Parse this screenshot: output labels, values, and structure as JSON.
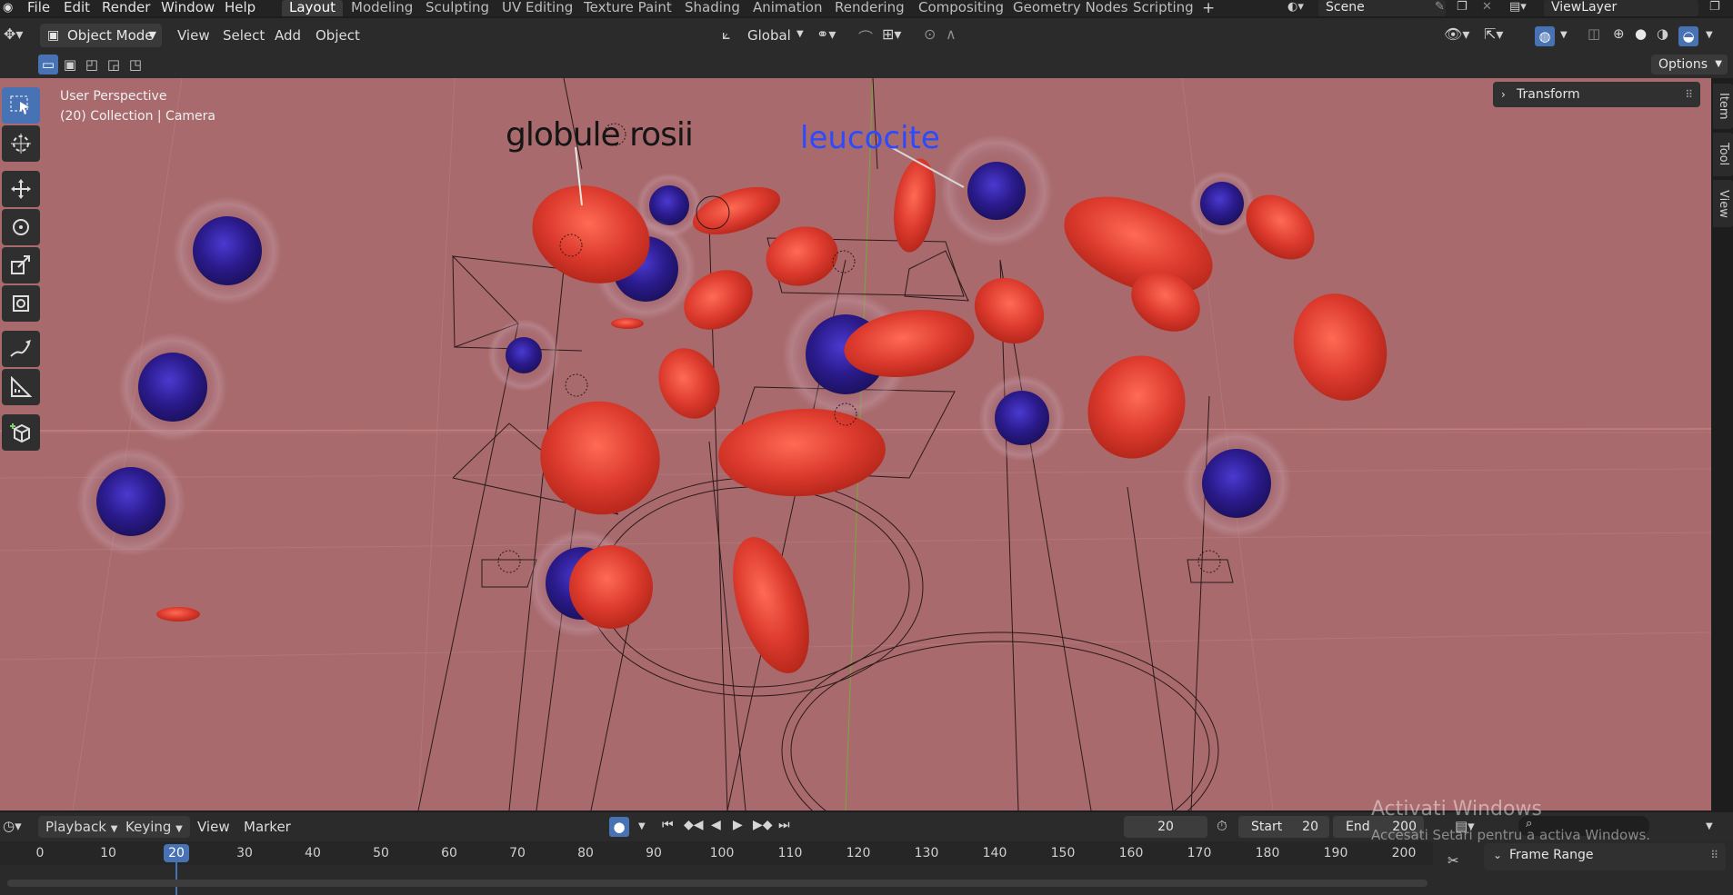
{
  "menu": [
    "File",
    "Edit",
    "Render",
    "Window",
    "Help"
  ],
  "workspaces": [
    "Layout",
    "Modeling",
    "Sculpting",
    "UV Editing",
    "Texture Paint",
    "Shading",
    "Animation",
    "Rendering",
    "Compositing",
    "Geometry Nodes",
    "Scripting"
  ],
  "active_workspace": "Layout",
  "scene_name": "Scene",
  "view_layer": "ViewLayer",
  "header": {
    "mode": "Object Mode",
    "menus": [
      "View",
      "Select",
      "Add",
      "Object"
    ],
    "transform_orientation": "Global",
    "options_label": "Options"
  },
  "viewport": {
    "perspective": "User Perspective",
    "collection_info": "(20) Collection | Camera",
    "label_red": "globule rosii",
    "label_blue": "leucocite",
    "background": "#a86a6c",
    "rbc_color": "#dd3b2e",
    "wbc_color": "#2a1a8a"
  },
  "sidebar": {
    "tabs": [
      "Item",
      "Tool",
      "View"
    ],
    "panel_title": "Transform"
  },
  "timeline": {
    "menus": [
      "Playback",
      "Keying",
      "View",
      "Marker"
    ],
    "current_frame": "20",
    "start_label": "Start",
    "start": "20",
    "end_label": "End",
    "end": "200",
    "ruler": [
      "0",
      "10",
      "20",
      "30",
      "40",
      "50",
      "60",
      "70",
      "80",
      "90",
      "100",
      "110",
      "120",
      "130",
      "140",
      "150",
      "160",
      "170",
      "180",
      "190",
      "200"
    ],
    "panel_title": "Frame Range"
  },
  "watermark": {
    "title": "Activati Windows",
    "subtitle": "Accesati Setari pentru a activa Windows."
  }
}
